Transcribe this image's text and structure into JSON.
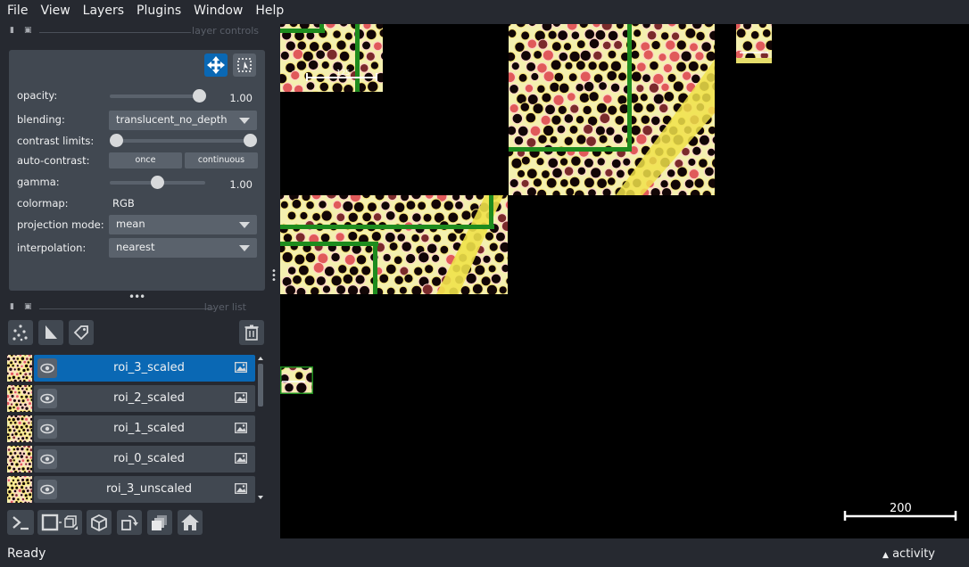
{
  "menu": [
    "File",
    "View",
    "Layers",
    "Plugins",
    "Window",
    "Help"
  ],
  "layer_controls": {
    "title": "layer controls",
    "opacity": {
      "label": "opacity:",
      "value": "1.00",
      "fraction": 1.0
    },
    "blending": {
      "label": "blending:",
      "value": "translucent_no_depth"
    },
    "contrast_limits": {
      "label": "contrast limits:",
      "low": 0.0,
      "high": 1.0
    },
    "auto_contrast": {
      "label": "auto-contrast:",
      "once": "once",
      "continuous": "continuous"
    },
    "gamma": {
      "label": "gamma:",
      "value": "1.00",
      "fraction": 0.5
    },
    "colormap": {
      "label": "colormap:",
      "value": "RGB"
    },
    "projection_mode": {
      "label": "projection mode:",
      "value": "mean"
    },
    "interpolation": {
      "label": "interpolation:",
      "value": "nearest"
    }
  },
  "layer_list": {
    "title": "layer list",
    "layers": [
      {
        "name": "roi_3_scaled",
        "selected": true
      },
      {
        "name": "roi_2_scaled",
        "selected": false
      },
      {
        "name": "roi_1_scaled",
        "selected": false
      },
      {
        "name": "roi_0_scaled",
        "selected": false
      },
      {
        "name": "roi_3_unscaled",
        "selected": false
      }
    ]
  },
  "canvas": {
    "scale_bar_label": "200",
    "inset_scale_label": "125"
  },
  "status": {
    "text": "Ready",
    "activity": "activity"
  },
  "colors": {
    "bg": "#262930",
    "panel": "#414851",
    "selected": "#0a68b4",
    "roi_outline": "#1e8c1e"
  }
}
